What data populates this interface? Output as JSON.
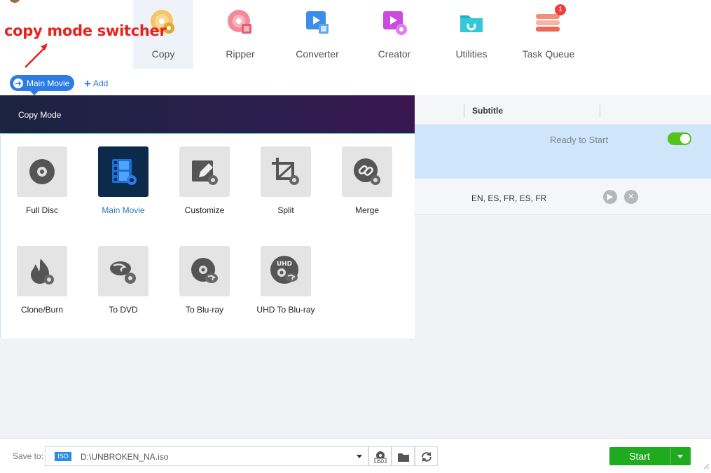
{
  "nav": {
    "tabs": [
      {
        "label": "Copy",
        "icon": "copy-disc-icon"
      },
      {
        "label": "Ripper",
        "icon": "ripper-icon"
      },
      {
        "label": "Converter",
        "icon": "converter-icon"
      },
      {
        "label": "Creator",
        "icon": "creator-icon"
      },
      {
        "label": "Utilities",
        "icon": "utilities-icon"
      },
      {
        "label": "Task Queue",
        "icon": "task-queue-icon"
      }
    ],
    "active": "Copy",
    "task_queue_badge": "1"
  },
  "annotation": {
    "text": "copy mode switcher",
    "color": "#e8211b"
  },
  "toolbar": {
    "mode_pill_label": "Main Movie",
    "add_label": "Add"
  },
  "copy_mode": {
    "title": "Copy Mode",
    "modes": [
      {
        "label": "Full Disc",
        "icon": "disc-icon"
      },
      {
        "label": "Main Movie",
        "icon": "film-icon",
        "selected": true
      },
      {
        "label": "Customize",
        "icon": "edit-icon"
      },
      {
        "label": "Split",
        "icon": "crop-icon"
      },
      {
        "label": "Merge",
        "icon": "link-icon"
      },
      {
        "label": "Clone/Burn",
        "icon": "flame-icon"
      },
      {
        "label": "To DVD",
        "icon": "bluray-to-dvd-icon"
      },
      {
        "label": "To Blu-ray",
        "icon": "disc-to-bluray-icon"
      },
      {
        "label": "UHD To Blu-ray",
        "icon": "uhd-bluray-icon"
      }
    ]
  },
  "list": {
    "header_subtitle": "Subtitle",
    "status": "Ready to Start",
    "subtitle_langs": "EN, ES, FR, ES, FR",
    "toggle_on": true
  },
  "bottom": {
    "save_to_label": "Save to:",
    "iso_tag": "ISO",
    "path": "D:\\UNBROKEN_NA.iso",
    "start_label": "Start"
  },
  "colors": {
    "accent": "#2d7be5",
    "start": "#1faa1f",
    "selected_row": "#cfe6fa",
    "toggle": "#52c41a"
  }
}
